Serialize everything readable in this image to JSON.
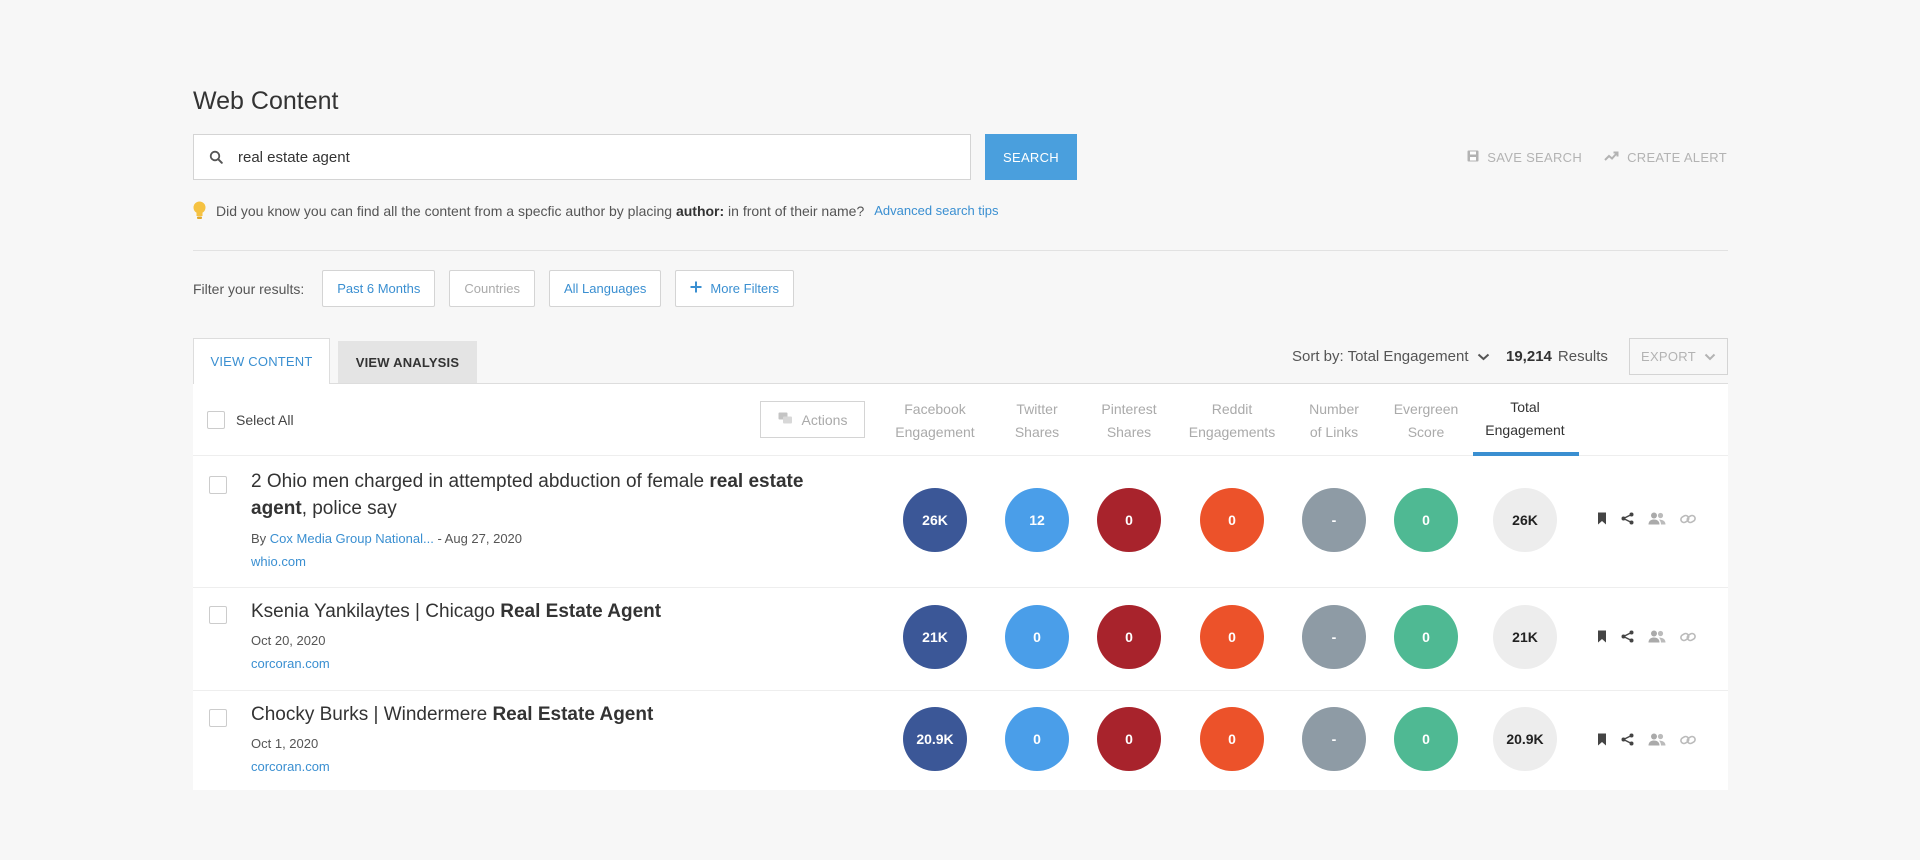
{
  "page_title": "Web Content",
  "search": {
    "value": "real estate agent",
    "button": "SEARCH"
  },
  "top_actions": {
    "save": "SAVE SEARCH",
    "alert": "CREATE ALERT"
  },
  "tip": {
    "prefix": "Did you know you can find all the content from a specfic author by placing",
    "keyword": "author:",
    "suffix": "in front of their name?",
    "link": "Advanced search tips"
  },
  "filters": {
    "label": "Filter your results:",
    "date": "Past 6 Months",
    "countries": "Countries",
    "languages": "All Languages",
    "more": "More Filters"
  },
  "tabs": {
    "content": "VIEW CONTENT",
    "analysis": "VIEW ANALYSIS"
  },
  "sort": {
    "label": "Sort by: Total Engagement"
  },
  "results": {
    "count": "19,214",
    "label": "Results"
  },
  "export": "EXPORT",
  "table": {
    "select_all": "Select All",
    "actions": "Actions",
    "columns": [
      {
        "line1": "Facebook",
        "line2": "Engagement"
      },
      {
        "line1": "Twitter",
        "line2": "Shares"
      },
      {
        "line1": "Pinterest",
        "line2": "Shares"
      },
      {
        "line1": "Reddit",
        "line2": "Engagements"
      },
      {
        "line1": "Number",
        "line2": "of Links"
      },
      {
        "line1": "Evergreen",
        "line2": "Score"
      },
      {
        "line1": "Total",
        "line2": "Engagement"
      }
    ],
    "rows": [
      {
        "title_a": "2 Ohio men charged in attempted abduction of female ",
        "title_b": "real estate agent",
        "title_c": ", police say",
        "by": "By ",
        "author": "Cox Media Group National...",
        "date": " - Aug 27, 2020",
        "domain": "whio.com",
        "values": [
          "26K",
          "12",
          "0",
          "0",
          "-",
          "0",
          "26K"
        ]
      },
      {
        "title_a": "Ksenia Yankilaytes | Chicago ",
        "title_b": "Real Estate Agent",
        "title_c": "",
        "date": "Oct 20, 2020",
        "domain": "corcoran.com",
        "values": [
          "21K",
          "0",
          "0",
          "0",
          "-",
          "0",
          "21K"
        ]
      },
      {
        "title_a": "Chocky Burks | Windermere ",
        "title_b": "Real Estate Agent",
        "title_c": "",
        "date": "Oct 1, 2020",
        "domain": "corcoran.com",
        "values": [
          "20.9K",
          "0",
          "0",
          "0",
          "-",
          "0",
          "20.9K"
        ]
      }
    ]
  },
  "colors": {
    "accent": "#4a9fdd",
    "facebook": "#3b5797",
    "twitter": "#4a9ee9",
    "pinterest": "#a8232c",
    "reddit": "#ec522a",
    "links": "#8e9ba5",
    "evergreen": "#4fb993",
    "total": "#ededed"
  }
}
